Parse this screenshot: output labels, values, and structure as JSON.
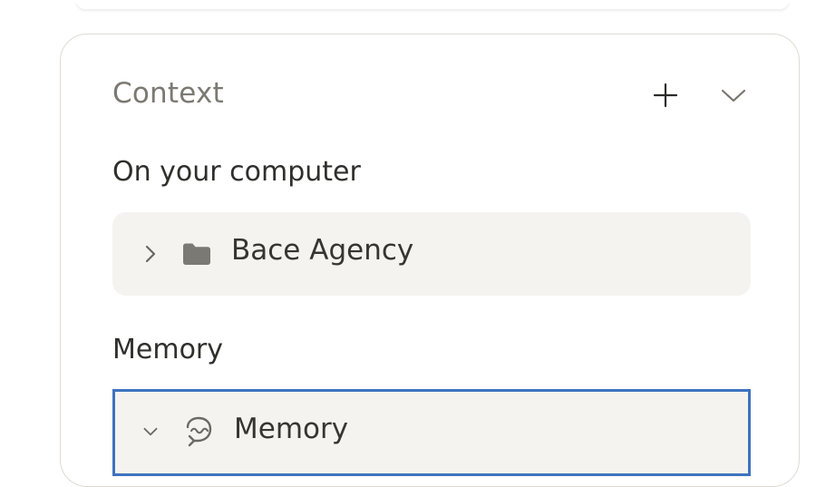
{
  "panel": {
    "title": "Context",
    "add_icon": "plus-icon",
    "collapse_icon": "chevron-down-icon"
  },
  "sections": {
    "computer": {
      "heading": "On your computer",
      "item": {
        "label": "Bace Agency",
        "icon": "folder-icon",
        "expand_icon": "chevron-right-icon"
      }
    },
    "memory": {
      "heading": "Memory",
      "item": {
        "label": "Memory",
        "icon": "memory-icon",
        "expand_icon": "chevron-down-icon"
      }
    }
  },
  "colors": {
    "panel_border": "#dedbd3",
    "item_background": "#f4f3ef",
    "focus_border": "#3d73bf",
    "muted_text": "#7b7971",
    "text": "#2f2f2c"
  }
}
